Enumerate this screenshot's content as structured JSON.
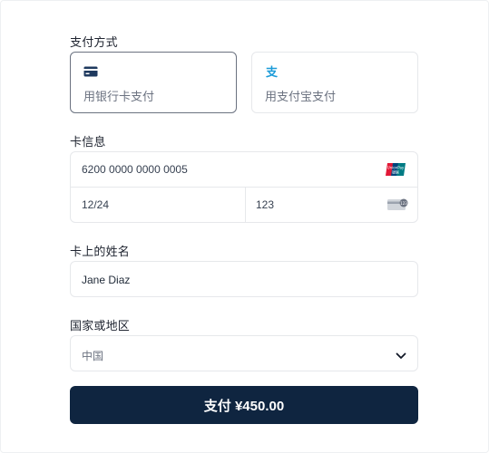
{
  "payment_method": {
    "label": "支付方式",
    "options": [
      {
        "label": "用银行卡支付",
        "icon": "credit-card-icon",
        "selected": true
      },
      {
        "label": "用支付宝支付",
        "icon": "alipay-icon",
        "selected": false
      }
    ]
  },
  "card_info": {
    "label": "卡信息",
    "number": "6200 0000 0000 0005",
    "expiry": "12/24",
    "cvc": "123",
    "brand_icon": "unionpay-icon",
    "cvc_icon": "cvc-card-icon",
    "brand_text_top": "UnionPay",
    "brand_text_bottom": "银联"
  },
  "cardholder": {
    "label": "卡上的姓名",
    "value": "Jane Diaz"
  },
  "country": {
    "label": "国家或地区",
    "value": "中国"
  },
  "submit": {
    "label": "支付 ¥450.00"
  },
  "colors": {
    "button_bg": "#0f2540",
    "alipay_blue": "#1c9bd8",
    "unionpay_red": "#e21836",
    "unionpay_blue": "#00447c",
    "unionpay_teal": "#007b84"
  }
}
